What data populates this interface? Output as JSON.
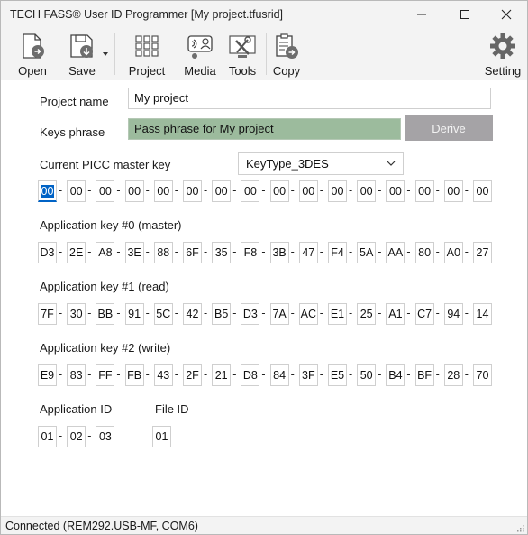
{
  "window": {
    "title": "TECH FASS® User ID Programmer [My project.tfusrid]"
  },
  "toolbar": {
    "open_label": "Open",
    "save_label": "Save",
    "project_label": "Project",
    "media_label": "Media",
    "tools_label": "Tools",
    "copy_label": "Copy",
    "setting_label": "Setting"
  },
  "form": {
    "project_name_label": "Project name",
    "project_name_value": "My project",
    "keys_phrase_label": "Keys phrase",
    "keys_phrase_value": "Pass phrase for My project",
    "derive_label": "Derive",
    "picc_label": "Current PICC master key",
    "key_type_value": "KeyType_3DES",
    "picc_key": [
      "00",
      "00",
      "00",
      "00",
      "00",
      "00",
      "00",
      "00",
      "00",
      "00",
      "00",
      "00",
      "00",
      "00",
      "00",
      "00"
    ],
    "app_key0_label": "Application key #0 (master)",
    "app_key0": [
      "D3",
      "2E",
      "A8",
      "3E",
      "88",
      "6F",
      "35",
      "F8",
      "3B",
      "47",
      "F4",
      "5A",
      "AA",
      "80",
      "A0",
      "27"
    ],
    "app_key1_label": "Application key #1 (read)",
    "app_key1": [
      "7F",
      "30",
      "BB",
      "91",
      "5C",
      "42",
      "B5",
      "D3",
      "7A",
      "AC",
      "E1",
      "25",
      "A1",
      "C7",
      "94",
      "14"
    ],
    "app_key2_label": "Application key #2 (write)",
    "app_key2": [
      "E9",
      "83",
      "FF",
      "FB",
      "43",
      "2F",
      "21",
      "D8",
      "84",
      "3F",
      "E5",
      "50",
      "B4",
      "BF",
      "28",
      "70"
    ],
    "app_id_label": "Application ID",
    "app_id": [
      "01",
      "02",
      "03"
    ],
    "file_id_label": "File ID",
    "file_id": "01"
  },
  "status": {
    "text": "Connected (REM292.USB-MF, COM6)"
  },
  "icons": [
    "open-icon",
    "save-icon",
    "project-icon",
    "media-icon",
    "tools-icon",
    "copy-icon",
    "setting-icon",
    "minimize-icon",
    "maximize-icon",
    "close-icon",
    "chevron-down-icon",
    "resize-grip-icon"
  ],
  "colors": {
    "phrase_bg": "#9cbb9d",
    "derive_bg": "#a5a3a6",
    "selection": "#0063c6"
  }
}
